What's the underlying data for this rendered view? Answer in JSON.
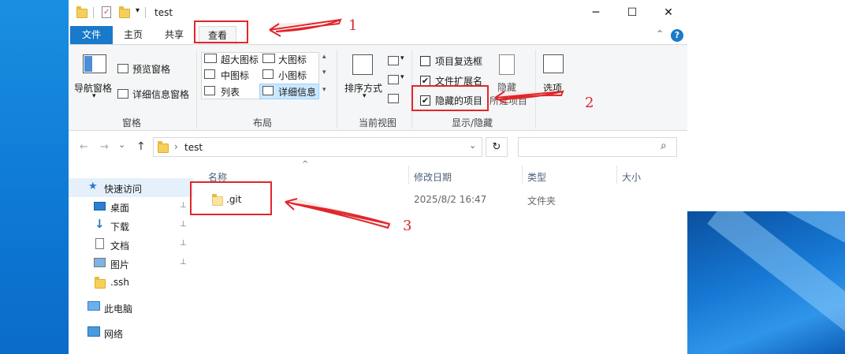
{
  "window": {
    "title": "test",
    "controls": {
      "minimize": "─",
      "maximize": "☐",
      "close": "✕"
    }
  },
  "ribbon_tabs": {
    "file": "文件",
    "home": "主页",
    "share": "共享",
    "view": "查看"
  },
  "ribbon": {
    "panes": {
      "nav_pane": "导航窗格",
      "preview_pane": "预览窗格",
      "details_pane": "详细信息窗格",
      "group_label": "窗格"
    },
    "layout": {
      "extra_large_icons": "超大图标",
      "large_icons": "大图标",
      "medium_icons": "中图标",
      "small_icons": "小图标",
      "list": "列表",
      "details": "详细信息",
      "group_label": "布局"
    },
    "current_view": {
      "sort_by": "排序方式",
      "group_label": "当前视图"
    },
    "show_hide": {
      "item_checkboxes": {
        "label": "项目复选框",
        "checked": false
      },
      "file_extensions": {
        "label": "文件扩展名",
        "checked": true
      },
      "hidden_items": {
        "label": "隐藏的项目",
        "checked": true
      },
      "hide_selected_top": "隐藏",
      "hide_selected_bottom": "所选项目",
      "group_label": "显示/隐藏"
    },
    "options": {
      "label": "选项"
    }
  },
  "address_bar": {
    "back": "←",
    "forward": "→",
    "recent": "⌄",
    "up": "↑",
    "separator": "›",
    "path": "test",
    "dropdown": "⌄",
    "refresh": "↻",
    "search_icon": "⌕"
  },
  "nav_pane": {
    "quick_access": "快速访问",
    "items": [
      {
        "label": "桌面",
        "icon": "desktop-icon",
        "pinned": true
      },
      {
        "label": "下载",
        "icon": "download-icon",
        "pinned": true
      },
      {
        "label": "文档",
        "icon": "document-icon",
        "pinned": true
      },
      {
        "label": "图片",
        "icon": "picture-icon",
        "pinned": true
      },
      {
        "label": ".ssh",
        "icon": "folder-icon",
        "pinned": false
      }
    ],
    "this_pc": "此电脑",
    "network": "网络",
    "pin_glyph": "📌"
  },
  "file_list": {
    "sort_glyph": "^",
    "columns": {
      "name": "名称",
      "modified": "修改日期",
      "type": "类型",
      "size": "大小"
    },
    "rows": [
      {
        "name": ".git",
        "modified": "2025/8/2 16:47",
        "type": "文件夹",
        "size": ""
      }
    ]
  },
  "annotations": {
    "one": "1",
    "two": "2",
    "three": "3"
  },
  "colors": {
    "accent": "#1979ca",
    "annotation_red": "#e0262a"
  }
}
